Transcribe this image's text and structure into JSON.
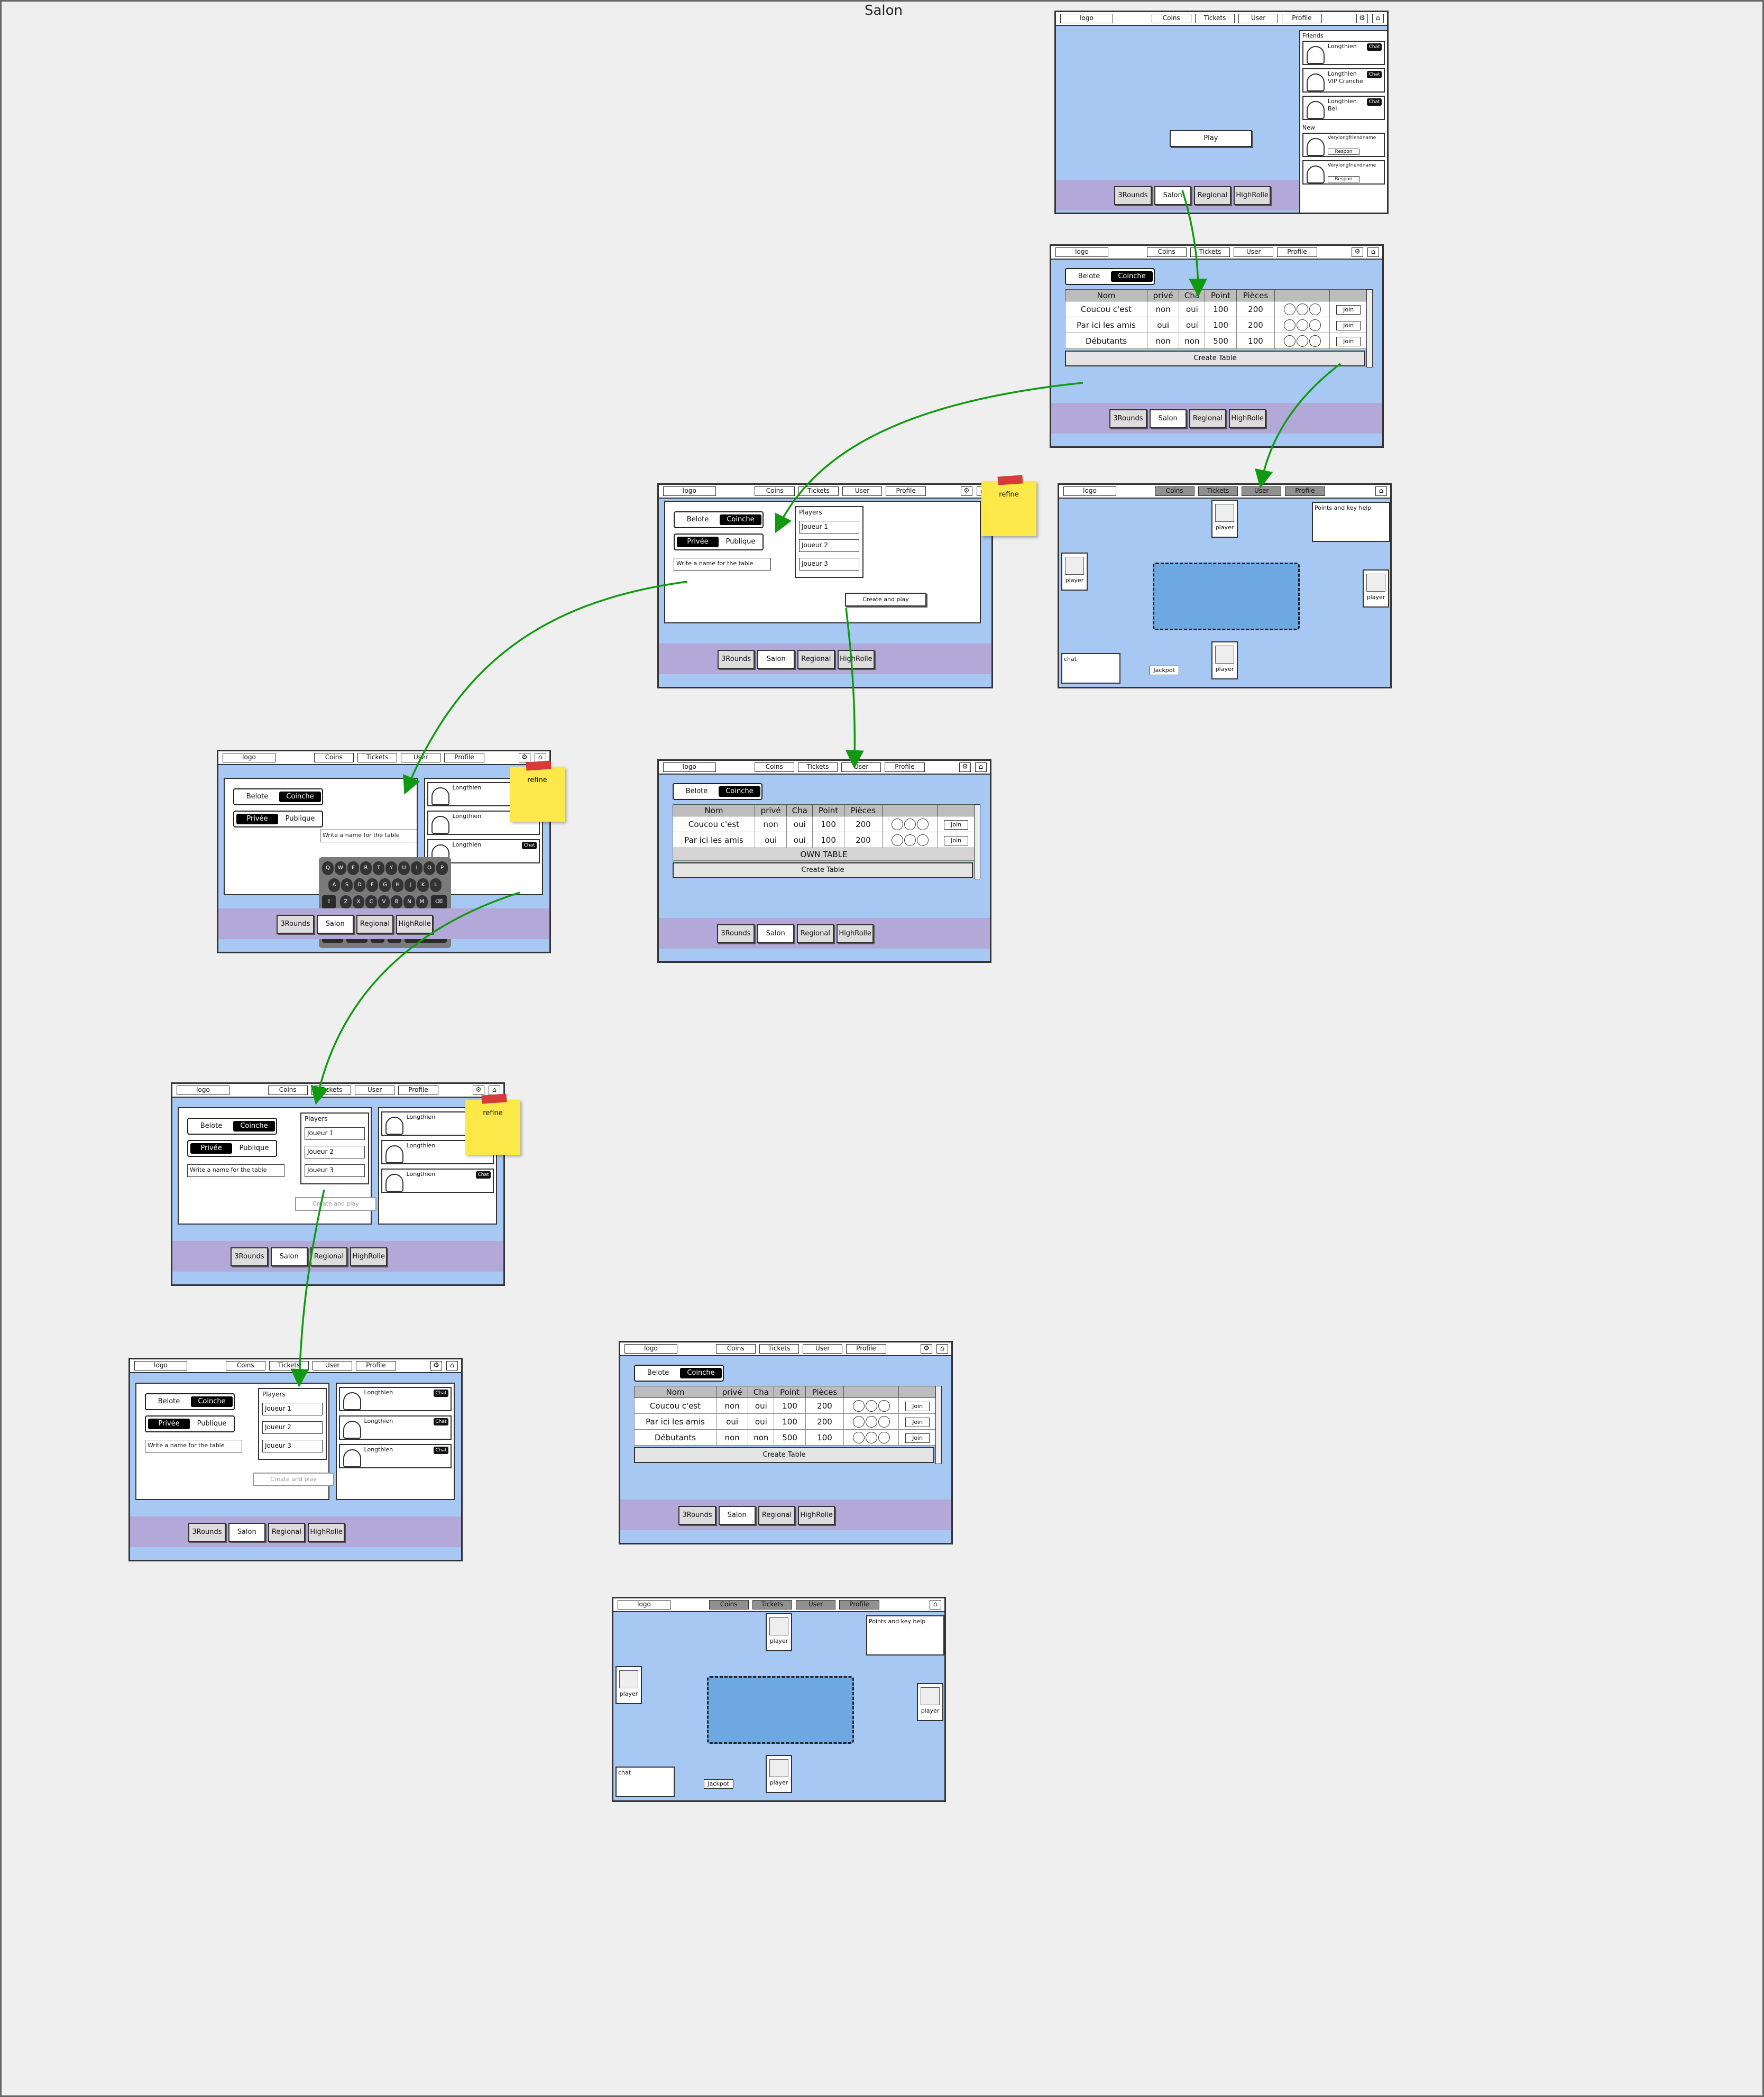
{
  "page_title": "Salon",
  "nav": {
    "logo": "logo",
    "coins": "Coins",
    "tickets": "Tickets",
    "user": "User",
    "profile": "Profile"
  },
  "footer": {
    "rounds": "3Rounds",
    "salon": "Salon",
    "regional": "Regional",
    "highrolle": "HighRolle"
  },
  "home": {
    "play": "Play",
    "friends_label": "Friends",
    "new_label": "New",
    "friends": [
      {
        "name": "Longthien",
        "sub": "",
        "badge": "Chat"
      },
      {
        "name": "Longthien",
        "sub": "VIP Cranche",
        "badge": "Chat"
      },
      {
        "name": "Longthien",
        "sub": "Bel",
        "badge": "Chat"
      }
    ],
    "new_friends": [
      {
        "name": "Verylongfriendname",
        "action": "Respon"
      },
      {
        "name": "Verylongfriendname",
        "action": "Respon"
      }
    ]
  },
  "lobby": {
    "toggle": [
      "Belote",
      "Coinche"
    ],
    "headers": [
      "Nom",
      "privé",
      "Cha",
      "Point",
      "Pièces"
    ],
    "rows": [
      {
        "nom": "Coucou c'est",
        "prive": "non",
        "cha": "oui",
        "point": "100",
        "pieces": "200",
        "join": "Join"
      },
      {
        "nom": "Par ici les amis",
        "prive": "oui",
        "cha": "oui",
        "point": "100",
        "pieces": "200",
        "join": "Join"
      },
      {
        "nom": "Débutants",
        "prive": "non",
        "cha": "non",
        "point": "500",
        "pieces": "100",
        "join": "Join"
      }
    ],
    "own_table": "OWN TABLE",
    "create_table": "Create Table"
  },
  "create": {
    "visibility": [
      "Privée",
      "Publique"
    ],
    "name_placeholder": "Write a name for the table",
    "players_title": "Players",
    "players": [
      "Joueur 1",
      "Joueur 2",
      "Joueur 3"
    ],
    "create_play": "Create and play",
    "sidebar_names": [
      "Longthien",
      "Longthien",
      "Longthien"
    ],
    "sidebar_badge": "Chat"
  },
  "game": {
    "player": "player",
    "points_help": "Points and key help",
    "chat": "chat",
    "jackpot": "Jackpot"
  },
  "sticky_label": "refine",
  "keyboard": {
    "row1": [
      "Q",
      "W",
      "E",
      "R",
      "T",
      "Y",
      "U",
      "I",
      "O",
      "P"
    ],
    "row2": [
      "A",
      "S",
      "D",
      "F",
      "G",
      "H",
      "J",
      "K",
      "L"
    ],
    "row3": [
      "Z",
      "X",
      "C",
      "V",
      "B",
      "N",
      "M"
    ],
    "bottom": [
      ".?123",
      "space",
      "@",
      ".",
      "return"
    ]
  }
}
